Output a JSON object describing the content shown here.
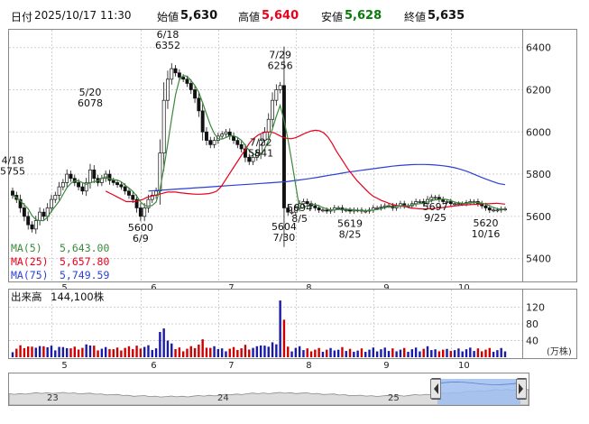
{
  "header": {
    "date_label": "日付",
    "datetime": "2025/10/17 11:30",
    "open_label": "始値",
    "open_value": "5,630",
    "high_label": "高値",
    "high_value": "5,640",
    "low_label": "安値",
    "low_value": "5,628",
    "close_label": "終値",
    "close_value": "5,635"
  },
  "colors": {
    "high": "#e8001c",
    "low": "#0a7a0a",
    "ma5": "#3a8a3a",
    "ma25": "#e8001c",
    "ma75": "#2b3fd6",
    "up_bar": "#0000ff",
    "down_bar": "#cc0000"
  },
  "legend": {
    "ma5_label": "MA(5)",
    "ma5_value": "5,643.00",
    "ma25_label": "MA(25)",
    "ma25_value": "5,657.80",
    "ma75_label": "MA(75)",
    "ma75_value": "5,749.59"
  },
  "volume": {
    "label": "出来高",
    "value": "144,100株",
    "unit": "(万株)",
    "ticks": [
      "120",
      "80",
      "40"
    ]
  },
  "chart_data": {
    "type": "line",
    "price_ticks": [
      5400,
      5600,
      5800,
      6000,
      6200,
      6400
    ],
    "ylim": [
      5300,
      6480
    ],
    "month_labels": [
      "5",
      "6",
      "7",
      "8",
      "9",
      "10"
    ],
    "month_x": [
      12,
      35,
      55,
      75,
      95,
      115
    ],
    "days_total": 128,
    "annotations": [
      {
        "date": "4/18",
        "value": "5755",
        "x": 0
      },
      {
        "date": "5/20",
        "value": "6078",
        "x": 20
      },
      {
        "date": "6/9",
        "value": "5600",
        "x": 33
      },
      {
        "date": "6/18",
        "value": "6352",
        "x": 40
      },
      {
        "date": "7/22",
        "value": "5841",
        "x": 64
      },
      {
        "date": "7/29",
        "value": "6256",
        "x": 69
      },
      {
        "date": "8/5",
        "value": "5694",
        "x": 74
      },
      {
        "date": "7/30",
        "value": "5604",
        "x": 70
      },
      {
        "date": "8/25",
        "value": "5619",
        "x": 87
      },
      {
        "date": "9/25",
        "value": "5697",
        "x": 109
      },
      {
        "date": "10/16",
        "value": "5620",
        "x": 122
      }
    ],
    "series": [
      {
        "name": "MA(5)",
        "values_key": "ma5"
      },
      {
        "name": "MA(25)",
        "values_key": "ma25"
      },
      {
        "name": "MA(75)",
        "values_key": "ma75"
      }
    ],
    "close": [
      5700,
      5680,
      5640,
      5600,
      5560,
      5540,
      5580,
      5620,
      5600,
      5640,
      5680,
      5700,
      5740,
      5760,
      5800,
      5780,
      5760,
      5740,
      5720,
      5760,
      5820,
      5780,
      5760,
      5780,
      5800,
      5770,
      5760,
      5750,
      5740,
      5720,
      5700,
      5680,
      5640,
      5600,
      5640,
      5680,
      5700,
      5720,
      5900,
      6150,
      6250,
      6300,
      6280,
      6260,
      6250,
      6230,
      6200,
      6160,
      6100,
      6000,
      5960,
      5940,
      5960,
      5980,
      5990,
      6000,
      5980,
      5960,
      5940,
      5920,
      5880,
      5860,
      5880,
      5900,
      5960,
      6000,
      6060,
      6150,
      6200,
      6220,
      5640,
      5620,
      5620,
      5640,
      5660,
      5670,
      5660,
      5650,
      5640,
      5630,
      5630,
      5625,
      5630,
      5640,
      5640,
      5630,
      5630,
      5625,
      5630,
      5630,
      5625,
      5625,
      5630,
      5640,
      5640,
      5645,
      5650,
      5650,
      5640,
      5650,
      5660,
      5650,
      5650,
      5660,
      5670,
      5670,
      5660,
      5680,
      5690,
      5690,
      5680,
      5670,
      5670,
      5660,
      5660,
      5660,
      5660,
      5665,
      5670,
      5670,
      5660,
      5650,
      5640,
      5630,
      5630,
      5630,
      5635,
      5635
    ],
    "ma25": [
      5720,
      5710,
      5700,
      5690,
      5680,
      5670,
      5670,
      5670,
      5675,
      5680,
      5690,
      5695,
      5700,
      5705,
      5710,
      5715,
      5715,
      5715,
      5712,
      5710,
      5708,
      5706,
      5705,
      5705,
      5706,
      5708,
      5712,
      5720,
      5740,
      5770,
      5800,
      5830,
      5860,
      5890,
      5920,
      5950,
      5970,
      5985,
      5995,
      6000,
      6000,
      5995,
      5985,
      5975,
      5970,
      5968,
      5972,
      5980,
      5990,
      5998,
      6005,
      6008,
      6005,
      5995,
      5975,
      5945,
      5910,
      5880,
      5850,
      5820,
      5795,
      5770,
      5750,
      5730,
      5710,
      5695,
      5685,
      5675,
      5668,
      5660,
      5655,
      5650,
      5648,
      5645,
      5640,
      5638,
      5636,
      5635,
      5635,
      5636,
      5638,
      5640,
      5642,
      5645,
      5648,
      5650,
      5652,
      5654,
      5655,
      5656,
      5657,
      5658,
      5660,
      5660,
      5661,
      5662,
      5660,
      5658
    ],
    "ma75": [
      5720,
      5722,
      5724,
      5726,
      5728,
      5730,
      5732,
      5734,
      5736,
      5738,
      5740,
      5742,
      5744,
      5746,
      5748,
      5750,
      5752,
      5754,
      5756,
      5758,
      5760,
      5762,
      5764,
      5768,
      5772,
      5776,
      5780,
      5785,
      5790,
      5795,
      5800,
      5805,
      5810,
      5814,
      5818,
      5822,
      5826,
      5830,
      5834,
      5838,
      5841,
      5843,
      5845,
      5846,
      5846,
      5845,
      5843,
      5840,
      5836,
      5830,
      5822,
      5812,
      5800,
      5788,
      5776,
      5765,
      5755,
      5750
    ]
  }
}
